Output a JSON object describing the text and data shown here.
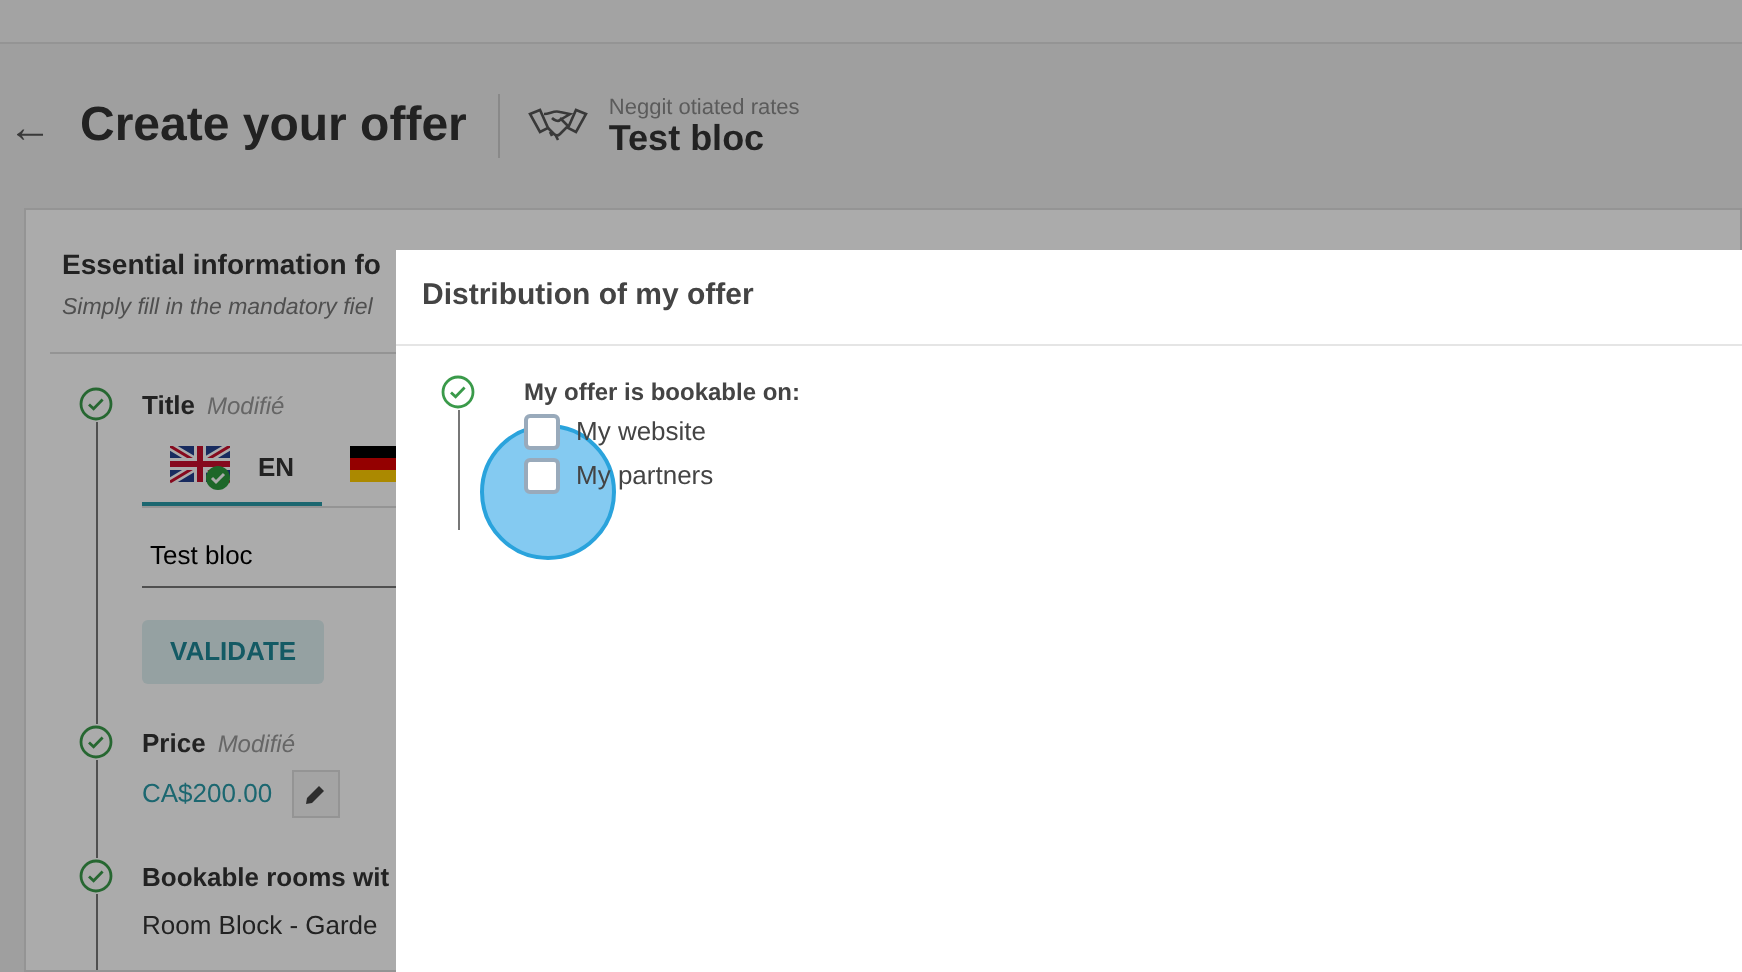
{
  "header": {
    "back": "←",
    "title": "Create your offer",
    "subtitle": "Neggit otiated rates",
    "offer_name": "Test bloc"
  },
  "card": {
    "title": "Essential information fo",
    "hint": "Simply fill in the mandatory fiel",
    "steps": [
      {
        "kind": "title",
        "done": true,
        "label": "Title",
        "tag": "Modifié",
        "tabs": [
          {
            "kind": "uk",
            "label": "EN",
            "selected": true,
            "validated": true
          },
          {
            "kind": "de",
            "selected": false,
            "validated": false
          }
        ],
        "value": "Test bloc",
        "button": "VALIDATE"
      },
      {
        "kind": "price",
        "done": true,
        "label": "Price",
        "tag": "Modifié",
        "value": "CA$200.00"
      },
      {
        "kind": "text",
        "done": true,
        "label": "Bookable rooms wit",
        "value": "Room Block - Garde"
      }
    ]
  },
  "modal": {
    "title": "Distribution of my offer",
    "done": true,
    "question": "My offer is bookable on:",
    "options": [
      {
        "label": "My website",
        "checked": false
      },
      {
        "label": "My partners",
        "checked": false
      }
    ],
    "click_indicator": true
  }
}
